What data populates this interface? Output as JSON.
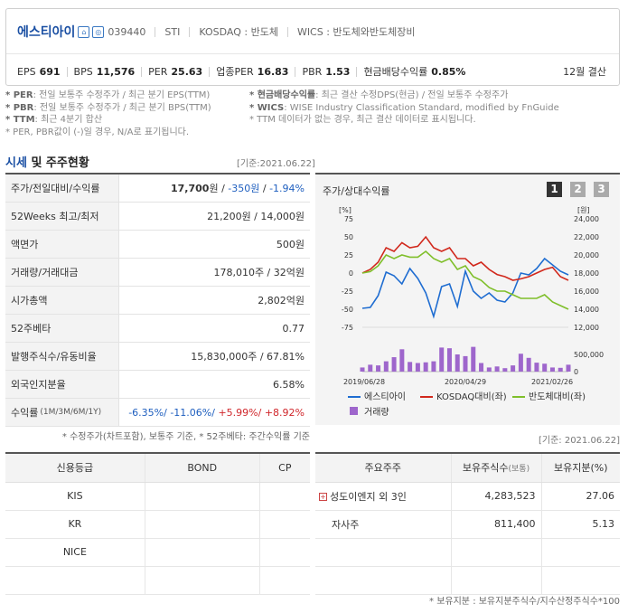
{
  "header": {
    "company": "에스티아이",
    "code": "039440",
    "ticker": "STI",
    "market": "KOSDAQ : 반도체",
    "wics": "WICS : 반도체와반도체장비",
    "icon1": "home-icon",
    "icon2": "ir-icon",
    "metrics": [
      {
        "label": "EPS",
        "value": "691"
      },
      {
        "label": "BPS",
        "value": "11,576"
      },
      {
        "label": "PER",
        "value": "25.63"
      },
      {
        "label": "업종PER",
        "value": "16.83"
      },
      {
        "label": "PBR",
        "value": "1.53"
      },
      {
        "label": "현금배당수익률",
        "value": "0.85%"
      }
    ],
    "settlement": "12월 결산"
  },
  "notes": {
    "left": [
      {
        "key": "* PER",
        "text": ": 전일 보통주 수정주가 / 최근 분기 EPS(TTM)"
      },
      {
        "key": "* PBR",
        "text": ": 전일 보통주 수정주가 / 최근 분기 BPS(TTM)"
      },
      {
        "key": "* TTM",
        "text": ": 최근 4분기 합산"
      },
      {
        "key": "",
        "text": "* PER, PBR값이 (-)일 경우, N/A로 표기됩니다."
      }
    ],
    "right": [
      {
        "key": "* 현금배당수익률",
        "text": ": 최근 결산 수정DPS(현금) / 전일 보통주 수정주가"
      },
      {
        "key": "* WICS",
        "text": ": WISE Industry Classification Standard, modified by FnGuide"
      },
      {
        "key": "",
        "text": "* TTM 데이터가 없는 경우, 최근 결산 데이터로 표시됩니다."
      }
    ]
  },
  "section": {
    "title_a": "시세",
    "title_b": " 및 주주현황",
    "basis": "[기준:2021.06.22]"
  },
  "price_table": [
    {
      "k": "주가/전일대비/수익률"
    },
    {
      "k": "52Weeks 최고/최저",
      "v": "21,200원 / 14,000원"
    },
    {
      "k": "액면가",
      "v": "500원"
    },
    {
      "k": "거래량/거래대금",
      "v": "178,010주 / 32억원"
    },
    {
      "k": "시가총액",
      "v": "2,802억원"
    },
    {
      "k": "52주베타",
      "v": "0.77"
    },
    {
      "k": "발행주식수/유동비율",
      "v": "15,830,000주 / 67.81%"
    },
    {
      "k": "외국인지분율",
      "v": "6.58%"
    },
    {
      "k": "수익률"
    }
  ],
  "price_row": {
    "price": "17,700",
    "won": "원",
    "sl1": " / ",
    "change": "-350원",
    "sl2": " / ",
    "pct": "-1.94%"
  },
  "return_row": {
    "label": "수익률",
    "periods": "(1M/3M/6M/1Y)",
    "r1": "-6.35%/",
    "r2": " -11.06%/",
    "r3": " +5.99%/",
    "r4": " +8.92%"
  },
  "table_note": "* 수정주가(차트포함), 보통주 기준, * 52주베타: 주간수익률 기준",
  "chart_panel": {
    "title": "주가/상대수익률",
    "pages": [
      "1",
      "2",
      "3"
    ],
    "left_unit": "[%]",
    "right_unit": "[원]"
  },
  "chart_data": {
    "type": "line",
    "x_labels": [
      "2019/06/28",
      "2020/04/29",
      "2021/02/26"
    ],
    "left_axis": {
      "ticks": [
        "75",
        "50",
        "25",
        "0",
        "-25",
        "-50",
        "-75"
      ],
      "min": -75,
      "max": 75
    },
    "right_axis": {
      "ticks": [
        "24,000",
        "22,000",
        "20,000",
        "18,000",
        "16,000",
        "14,000",
        "12,000"
      ],
      "min": 12000,
      "max": 24000
    },
    "volume_axis": {
      "ticks": [
        "500,000",
        "0"
      ],
      "max": 1000000
    },
    "series": [
      {
        "name": "에스티아이",
        "color": "#1f6dd1",
        "axis": "right",
        "values": [
          14100,
          14200,
          15500,
          18100,
          17700,
          16800,
          18500,
          17400,
          15800,
          13200,
          16500,
          16800,
          14300,
          18200,
          16000,
          15200,
          15800,
          15000,
          14800,
          15800,
          18000,
          17800,
          18500,
          19600,
          18900,
          18200,
          17800
        ]
      },
      {
        "name": "KOSDAQ대비(좌)",
        "color": "#d1281c",
        "axis": "left",
        "values": [
          0,
          5,
          15,
          35,
          30,
          42,
          35,
          37,
          50,
          35,
          30,
          35,
          20,
          20,
          10,
          15,
          5,
          -2,
          -5,
          -10,
          -8,
          -5,
          0,
          5,
          8,
          -5,
          -10
        ]
      },
      {
        "name": "반도체대비(좌)",
        "color": "#7fbf2a",
        "axis": "left",
        "values": [
          0,
          2,
          10,
          25,
          20,
          25,
          22,
          22,
          30,
          20,
          15,
          20,
          5,
          10,
          -5,
          -10,
          -20,
          -25,
          -25,
          -30,
          -35,
          -35,
          -35,
          -30,
          -40,
          -45,
          -50
        ]
      },
      {
        "name": "거래량",
        "color": "#9e66cc",
        "axis": "volume",
        "type": "bar",
        "values": [
          120000,
          200000,
          180000,
          300000,
          420000,
          650000,
          280000,
          250000,
          270000,
          300000,
          700000,
          680000,
          500000,
          450000,
          720000,
          250000,
          120000,
          150000,
          100000,
          180000,
          520000,
          400000,
          260000,
          230000,
          120000,
          110000,
          200000
        ]
      }
    ]
  },
  "credit_table": {
    "headers": [
      "신용등급",
      "BOND",
      "CP"
    ],
    "rows": [
      [
        "KIS",
        "",
        ""
      ],
      [
        "KR",
        "",
        ""
      ],
      [
        "NICE",
        "",
        ""
      ],
      [
        "",
        "",
        ""
      ]
    ]
  },
  "shareholder_table": {
    "basis": "[기준: 2021.06.22]",
    "headers": [
      "주요주주",
      "보유주식수",
      "(보통)",
      "보유지분(%)"
    ],
    "rows": [
      [
        "성도이엔지 외 3인",
        "4,283,523",
        "27.06"
      ],
      [
        "자사주",
        "811,400",
        "5.13"
      ],
      [
        "",
        "",
        ""
      ],
      [
        "",
        "",
        ""
      ]
    ],
    "footnote": "* 보유지분 : 보유지분주식수/지수산정주식수*100"
  }
}
